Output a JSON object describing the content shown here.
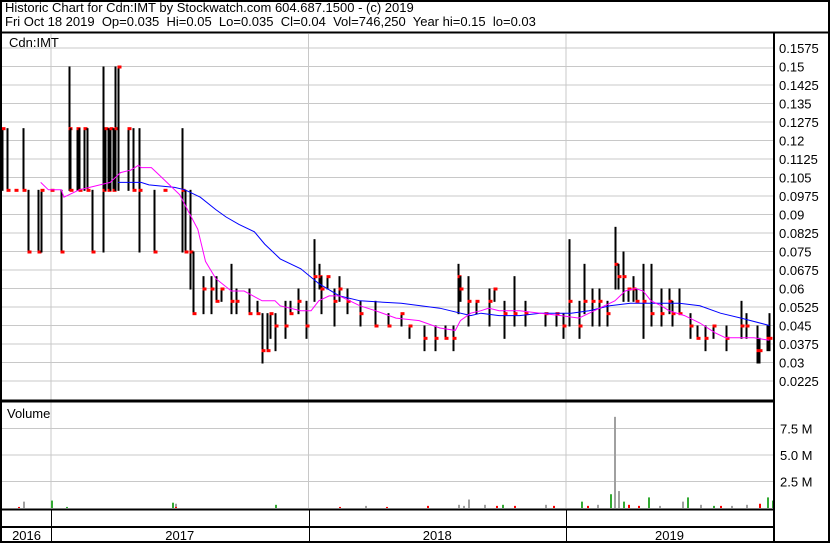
{
  "header": {
    "title": "Historic Chart for Cdn:IMT by Stockwatch.com 604.687.1500 - (c) 2019",
    "quote_line": "Fri Oct 18 2019  Op=0.035  Hi=0.05  Lo=0.035  Cl=0.04  Vol=746,250  Year hi=0.15  lo=0.03"
  },
  "colors": {
    "bar": "#000000",
    "close_tick": "#ff0000",
    "ma_short": "#ff00ff",
    "ma_long": "#0000ff",
    "vol_up": "#33aa33",
    "vol_down": "#ff0000",
    "vol_flat": "#a0a0a0",
    "grid": "#c8c8c8"
  },
  "chart_data": [
    {
      "type": "ohlc",
      "title": "Cdn:IMT",
      "x_range": [
        2016.81,
        2019.81
      ],
      "ylim": [
        0.0175,
        0.1625
      ],
      "y_ticks": [
        "0.1575",
        "0.15",
        "0.1425",
        "0.135",
        "0.1275",
        "0.12",
        "0.1125",
        "0.105",
        "0.0975",
        "0.09",
        "0.0825",
        "0.075",
        "0.0675",
        "0.06",
        "0.0525",
        "0.045",
        "0.0375",
        "0.03",
        "0.0225"
      ],
      "x_labels": [
        {
          "label": "2016",
          "from": 2016.81,
          "to": 2017.0
        },
        {
          "label": "2017",
          "from": 2017.0,
          "to": 2018.0
        },
        {
          "label": "2018",
          "from": 2018.0,
          "to": 2019.0
        },
        {
          "label": "2019",
          "from": 2019.0,
          "to": 2019.81
        }
      ],
      "grid": true,
      "bars_t_hi_lo_close": [
        [
          2016.81,
          0.125,
          0.1,
          0.125
        ],
        [
          2016.83,
          0.125,
          0.1,
          0.1
        ],
        [
          2016.86,
          0.1,
          0.1,
          0.1
        ],
        [
          2016.89,
          0.125,
          0.1,
          0.1
        ],
        [
          2016.91,
          0.1,
          0.075,
          0.075
        ],
        [
          2016.95,
          0.1,
          0.075,
          0.075
        ],
        [
          2016.96,
          0.1,
          0.075,
          0.1
        ],
        [
          2017.0,
          0.1,
          0.1,
          0.1
        ],
        [
          2017.04,
          0.1,
          0.075,
          0.075
        ],
        [
          2017.07,
          0.15,
          0.1,
          0.125
        ],
        [
          2017.075,
          0.125,
          0.1,
          0.1
        ],
        [
          2017.1,
          0.125,
          0.1,
          0.125
        ],
        [
          2017.11,
          0.125,
          0.1,
          0.1
        ],
        [
          2017.13,
          0.125,
          0.1,
          0.125
        ],
        [
          2017.14,
          0.125,
          0.1,
          0.1
        ],
        [
          2017.16,
          0.1,
          0.075,
          0.075
        ],
        [
          2017.2,
          0.15,
          0.075,
          0.1
        ],
        [
          2017.21,
          0.125,
          0.1,
          0.125
        ],
        [
          2017.22,
          0.125,
          0.1,
          0.1
        ],
        [
          2017.23,
          0.125,
          0.1,
          0.125
        ],
        [
          2017.24,
          0.125,
          0.1,
          0.1
        ],
        [
          2017.25,
          0.15,
          0.1,
          0.125
        ],
        [
          2017.26,
          0.15,
          0.1,
          0.15
        ],
        [
          2017.3,
          0.125,
          0.1,
          0.125
        ],
        [
          2017.32,
          0.125,
          0.1,
          0.1
        ],
        [
          2017.34,
          0.125,
          0.075,
          0.1
        ],
        [
          2017.4,
          0.1,
          0.075,
          0.075
        ],
        [
          2017.44,
          0.1,
          0.1,
          0.1
        ],
        [
          2017.51,
          0.125,
          0.075,
          0.1
        ],
        [
          2017.52,
          0.1,
          0.075,
          0.075
        ],
        [
          2017.54,
          0.1,
          0.06,
          0.075
        ],
        [
          2017.55,
          0.075,
          0.05,
          0.05
        ],
        [
          2017.59,
          0.065,
          0.05,
          0.06
        ],
        [
          2017.62,
          0.065,
          0.05,
          0.06
        ],
        [
          2017.64,
          0.065,
          0.055,
          0.055
        ],
        [
          2017.66,
          0.06,
          0.055,
          0.06
        ],
        [
          2017.7,
          0.07,
          0.05,
          0.055
        ],
        [
          2017.72,
          0.06,
          0.05,
          0.055
        ],
        [
          2017.77,
          0.06,
          0.05,
          0.05
        ],
        [
          2017.8,
          0.055,
          0.05,
          0.05
        ],
        [
          2017.82,
          0.05,
          0.03,
          0.035
        ],
        [
          2017.84,
          0.05,
          0.035,
          0.035
        ],
        [
          2017.85,
          0.05,
          0.04,
          0.05
        ],
        [
          2017.87,
          0.05,
          0.035,
          0.045
        ],
        [
          2017.91,
          0.055,
          0.04,
          0.045
        ],
        [
          2017.93,
          0.055,
          0.05,
          0.05
        ],
        [
          2017.96,
          0.06,
          0.05,
          0.055
        ],
        [
          2017.99,
          0.055,
          0.04,
          0.045
        ],
        [
          2018.02,
          0.08,
          0.055,
          0.065
        ],
        [
          2018.04,
          0.07,
          0.06,
          0.065
        ],
        [
          2018.05,
          0.065,
          0.05,
          0.06
        ],
        [
          2018.07,
          0.065,
          0.06,
          0.065
        ],
        [
          2018.1,
          0.06,
          0.045,
          0.055
        ],
        [
          2018.12,
          0.065,
          0.055,
          0.06
        ],
        [
          2018.15,
          0.06,
          0.05,
          0.055
        ],
        [
          2018.2,
          0.055,
          0.045,
          0.05
        ],
        [
          2018.26,
          0.055,
          0.045,
          0.045
        ],
        [
          2018.31,
          0.05,
          0.045,
          0.045
        ],
        [
          2018.36,
          0.05,
          0.045,
          0.05
        ],
        [
          2018.39,
          0.045,
          0.04,
          0.045
        ],
        [
          2018.45,
          0.045,
          0.035,
          0.04
        ],
        [
          2018.49,
          0.045,
          0.035,
          0.04
        ],
        [
          2018.53,
          0.045,
          0.04,
          0.04
        ],
        [
          2018.56,
          0.045,
          0.035,
          0.04
        ],
        [
          2018.58,
          0.07,
          0.05,
          0.065
        ],
        [
          2018.59,
          0.065,
          0.055,
          0.06
        ],
        [
          2018.62,
          0.065,
          0.045,
          0.055
        ],
        [
          2018.65,
          0.055,
          0.05,
          0.055
        ],
        [
          2018.7,
          0.06,
          0.045,
          0.055
        ],
        [
          2018.72,
          0.06,
          0.055,
          0.06
        ],
        [
          2018.76,
          0.055,
          0.04,
          0.05
        ],
        [
          2018.8,
          0.065,
          0.045,
          0.05
        ],
        [
          2018.84,
          0.055,
          0.045,
          0.05
        ],
        [
          2018.92,
          0.05,
          0.045,
          0.05
        ],
        [
          2018.96,
          0.05,
          0.045,
          0.05
        ],
        [
          2018.99,
          0.05,
          0.04,
          0.045
        ],
        [
          2019.01,
          0.08,
          0.045,
          0.055
        ],
        [
          2019.05,
          0.055,
          0.04,
          0.045
        ],
        [
          2019.07,
          0.07,
          0.05,
          0.055
        ],
        [
          2019.1,
          0.06,
          0.045,
          0.055
        ],
        [
          2019.13,
          0.06,
          0.045,
          0.055
        ],
        [
          2019.16,
          0.055,
          0.045,
          0.05
        ],
        [
          2019.19,
          0.085,
          0.06,
          0.07
        ],
        [
          2019.2,
          0.07,
          0.06,
          0.065
        ],
        [
          2019.22,
          0.075,
          0.055,
          0.065
        ],
        [
          2019.24,
          0.06,
          0.055,
          0.06
        ],
        [
          2019.26,
          0.065,
          0.055,
          0.06
        ],
        [
          2019.27,
          0.06,
          0.055,
          0.055
        ],
        [
          2019.3,
          0.07,
          0.04,
          0.055
        ],
        [
          2019.33,
          0.07,
          0.045,
          0.05
        ],
        [
          2019.37,
          0.06,
          0.045,
          0.05
        ],
        [
          2019.4,
          0.06,
          0.05,
          0.055
        ],
        [
          2019.41,
          0.055,
          0.045,
          0.05
        ],
        [
          2019.44,
          0.06,
          0.05,
          0.05
        ],
        [
          2019.48,
          0.05,
          0.04,
          0.045
        ],
        [
          2019.51,
          0.045,
          0.04,
          0.04
        ],
        [
          2019.54,
          0.045,
          0.035,
          0.04
        ],
        [
          2019.57,
          0.045,
          0.04,
          0.045
        ],
        [
          2019.62,
          0.045,
          0.035,
          0.04
        ],
        [
          2019.68,
          0.055,
          0.04,
          0.045
        ],
        [
          2019.7,
          0.05,
          0.04,
          0.045
        ],
        [
          2019.74,
          0.045,
          0.03,
          0.035
        ],
        [
          2019.75,
          0.04,
          0.03,
          0.035
        ],
        [
          2019.78,
          0.045,
          0.035,
          0.04
        ],
        [
          2019.79,
          0.05,
          0.035,
          0.04
        ]
      ],
      "ma_short": [
        [
          2016.96,
          0.103
        ],
        [
          2016.99,
          0.1
        ],
        [
          2017.04,
          0.1
        ],
        [
          2017.05,
          0.097
        ],
        [
          2017.11,
          0.1
        ],
        [
          2017.15,
          0.101
        ],
        [
          2017.19,
          0.102
        ],
        [
          2017.23,
          0.103
        ],
        [
          2017.25,
          0.105
        ],
        [
          2017.27,
          0.107
        ],
        [
          2017.31,
          0.108
        ],
        [
          2017.34,
          0.11
        ],
        [
          2017.35,
          0.109
        ],
        [
          2017.39,
          0.109
        ],
        [
          2017.42,
          0.106
        ],
        [
          2017.46,
          0.102
        ],
        [
          2017.5,
          0.098
        ],
        [
          2017.54,
          0.09
        ],
        [
          2017.57,
          0.084
        ],
        [
          2017.6,
          0.071
        ],
        [
          2017.64,
          0.064
        ],
        [
          2017.7,
          0.059
        ],
        [
          2017.75,
          0.059
        ],
        [
          2017.82,
          0.055
        ],
        [
          2017.87,
          0.055
        ],
        [
          2017.89,
          0.053
        ],
        [
          2017.97,
          0.051
        ],
        [
          2018.01,
          0.051
        ],
        [
          2018.04,
          0.055
        ],
        [
          2018.08,
          0.057
        ],
        [
          2018.12,
          0.057
        ],
        [
          2018.16,
          0.055
        ],
        [
          2018.2,
          0.053
        ],
        [
          2018.26,
          0.051
        ],
        [
          2018.34,
          0.048
        ],
        [
          2018.43,
          0.047
        ],
        [
          2018.51,
          0.044
        ],
        [
          2018.57,
          0.043
        ],
        [
          2018.59,
          0.047
        ],
        [
          2018.63,
          0.05
        ],
        [
          2018.67,
          0.051
        ],
        [
          2018.7,
          0.052
        ],
        [
          2018.74,
          0.051
        ],
        [
          2018.82,
          0.051
        ],
        [
          2018.9,
          0.05
        ],
        [
          2018.98,
          0.049
        ],
        [
          2019.05,
          0.048
        ],
        [
          2019.09,
          0.05
        ],
        [
          2019.13,
          0.052
        ],
        [
          2019.19,
          0.055
        ],
        [
          2019.23,
          0.059
        ],
        [
          2019.27,
          0.06
        ],
        [
          2019.3,
          0.059
        ],
        [
          2019.33,
          0.055
        ],
        [
          2019.37,
          0.053
        ],
        [
          2019.4,
          0.051
        ],
        [
          2019.46,
          0.049
        ],
        [
          2019.52,
          0.046
        ],
        [
          2019.58,
          0.042
        ],
        [
          2019.62,
          0.04
        ],
        [
          2019.68,
          0.04
        ],
        [
          2019.73,
          0.04
        ],
        [
          2019.79,
          0.039
        ]
      ],
      "ma_long": [
        [
          2017.26,
          0.103
        ],
        [
          2017.35,
          0.103
        ],
        [
          2017.38,
          0.102
        ],
        [
          2017.48,
          0.101
        ],
        [
          2017.52,
          0.1
        ],
        [
          2017.58,
          0.097
        ],
        [
          2017.64,
          0.092
        ],
        [
          2017.68,
          0.089
        ],
        [
          2017.73,
          0.086
        ],
        [
          2017.79,
          0.083
        ],
        [
          2017.83,
          0.078
        ],
        [
          2017.89,
          0.072
        ],
        [
          2017.97,
          0.068
        ],
        [
          2018.04,
          0.062
        ],
        [
          2018.12,
          0.057
        ],
        [
          2018.2,
          0.055
        ],
        [
          2018.36,
          0.054
        ],
        [
          2018.51,
          0.052
        ],
        [
          2018.63,
          0.049
        ],
        [
          2018.67,
          0.05
        ],
        [
          2018.74,
          0.049
        ],
        [
          2018.82,
          0.049
        ],
        [
          2018.9,
          0.05
        ],
        [
          2019.02,
          0.05
        ],
        [
          2019.09,
          0.051
        ],
        [
          2019.17,
          0.053
        ],
        [
          2019.25,
          0.054
        ],
        [
          2019.33,
          0.054
        ],
        [
          2019.44,
          0.054
        ],
        [
          2019.52,
          0.053
        ],
        [
          2019.6,
          0.05
        ],
        [
          2019.68,
          0.048
        ],
        [
          2019.79,
          0.045
        ]
      ]
    },
    {
      "type": "bar",
      "title": "Volume",
      "ylim": [
        0,
        10
      ],
      "yunit": "M",
      "y_ticks": [
        "7.5 M",
        "5.0 M",
        "2.5 M"
      ],
      "y_tick_values": [
        7.5,
        5.0,
        2.5
      ],
      "bars_t_volM_dir": [
        [
          2016.87,
          0.1,
          "down"
        ],
        [
          2016.89,
          0.6,
          "flat"
        ],
        [
          2017.0,
          0.7,
          "up"
        ],
        [
          2017.06,
          0.1,
          "up"
        ],
        [
          2017.47,
          0.5,
          "up"
        ],
        [
          2017.48,
          0.4,
          "flat"
        ],
        [
          2017.48,
          0.1,
          "down"
        ],
        [
          2017.87,
          0.3,
          "up"
        ],
        [
          2018.12,
          0.1,
          "down"
        ],
        [
          2018.22,
          0.2,
          "flat"
        ],
        [
          2018.3,
          0.1,
          "down"
        ],
        [
          2018.46,
          0.2,
          "down"
        ],
        [
          2018.58,
          0.3,
          "flat"
        ],
        [
          2018.6,
          0.2,
          "flat"
        ],
        [
          2018.62,
          0.8,
          "flat"
        ],
        [
          2018.68,
          0.3,
          "flat"
        ],
        [
          2018.73,
          0.2,
          "down"
        ],
        [
          2018.75,
          0.3,
          "up"
        ],
        [
          2018.8,
          0.2,
          "down"
        ],
        [
          2018.92,
          0.3,
          "flat"
        ],
        [
          2018.95,
          0.2,
          "down"
        ],
        [
          2019.06,
          0.6,
          "up"
        ],
        [
          2019.08,
          0.2,
          "down"
        ],
        [
          2019.12,
          0.3,
          "flat"
        ],
        [
          2019.17,
          1.3,
          "up"
        ],
        [
          2019.185,
          8.6,
          "flat"
        ],
        [
          2019.2,
          1.6,
          "flat"
        ],
        [
          2019.22,
          0.6,
          "up"
        ],
        [
          2019.24,
          0.3,
          "down"
        ],
        [
          2019.28,
          0.2,
          "down"
        ],
        [
          2019.32,
          1.0,
          "up"
        ],
        [
          2019.36,
          0.2,
          "flat"
        ],
        [
          2019.45,
          0.6,
          "flat"
        ],
        [
          2019.47,
          1.0,
          "up"
        ],
        [
          2019.52,
          0.3,
          "flat"
        ],
        [
          2019.57,
          0.2,
          "up"
        ],
        [
          2019.6,
          0.2,
          "down"
        ],
        [
          2019.64,
          0.2,
          "flat"
        ],
        [
          2019.7,
          0.3,
          "flat"
        ],
        [
          2019.75,
          0.4,
          "down"
        ],
        [
          2019.78,
          1.0,
          "up"
        ],
        [
          2019.8,
          0.7,
          "up"
        ]
      ]
    }
  ]
}
